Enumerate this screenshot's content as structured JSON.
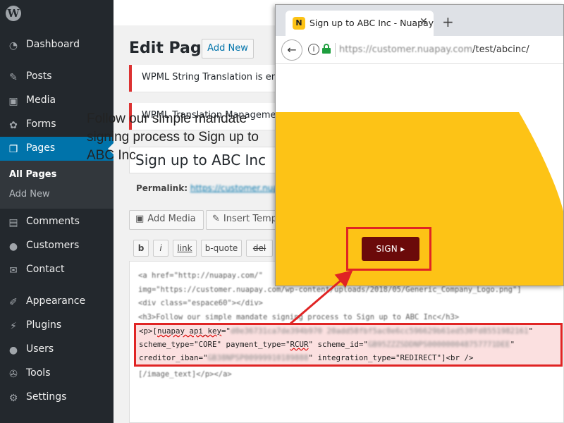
{
  "sidebar": {
    "logo": "W",
    "items": [
      {
        "label": "Dashboard",
        "icon": "dashboard-icon",
        "glyph": "◔"
      },
      {
        "label": "Posts",
        "icon": "pushpin-icon",
        "glyph": "✎"
      },
      {
        "label": "Media",
        "icon": "media-icon",
        "glyph": "▣"
      },
      {
        "label": "Forms",
        "icon": "forms-icon",
        "glyph": "✿"
      },
      {
        "label": "Pages",
        "icon": "pages-icon",
        "glyph": "❐"
      },
      {
        "label": "Comments",
        "icon": "comment-icon",
        "glyph": "▤"
      },
      {
        "label": "Customers",
        "icon": "person-icon",
        "glyph": "●"
      },
      {
        "label": "Contact",
        "icon": "envelope-icon",
        "glyph": "✉"
      },
      {
        "label": "Appearance",
        "icon": "paintbrush-icon",
        "glyph": "✐"
      },
      {
        "label": "Plugins",
        "icon": "plug-icon",
        "glyph": "⚡"
      },
      {
        "label": "Users",
        "icon": "users-icon",
        "glyph": "●"
      },
      {
        "label": "Tools",
        "icon": "wrench-icon",
        "glyph": "✇"
      },
      {
        "label": "Settings",
        "icon": "settings-icon",
        "glyph": "⚙"
      }
    ],
    "submenu": {
      "all_pages": "All Pages",
      "add_new": "Add New"
    }
  },
  "editor": {
    "heading": "Edit Page",
    "add_new": "Add New",
    "notice_1": "WPML String Translation is enabl",
    "notice_2": "WPML Translation Management",
    "title_value": "Sign up to ABC Inc",
    "permalink_label": "Permalink:",
    "permalink_url": "https://customer.nuapay",
    "add_media": "Add Media",
    "insert_template": "Insert Temp",
    "quicktags": [
      "b",
      "i",
      "link",
      "b-quote",
      "del"
    ],
    "code_lines": [
      "<a href=\"http://nuapay.com/\"",
      "img=\"https://customer.nuapay.com/wp-content/uploads/2018/05/Generic_Company_Logo.png\"]",
      "<div class=\"espace60\"></div>",
      "<h3>Follow our simple mandate signing process to Sign up to ABC Inc</h3>",
      "[/image_text]</p></a>"
    ]
  },
  "shortcode": {
    "line1_a": "<p>[",
    "line1_b": "nuapay api_key",
    "line1_c": "=\"",
    "line1_key": "d0e36731ca7de394b970 20add58fbf5ac0e6cc596629b61ed530fd8551982161",
    "line1_d": "\"",
    "line2_a": "scheme_type=\"CORE\" payment_type=\"",
    "line2_b": "RCUR",
    "line2_c": "\" scheme_id=\"",
    "line2_id": "GB95ZZZSDDNPS000000048757771DEE",
    "line2_d": "\"",
    "line3_a": "creditor_iban=\"",
    "line3_iban": "GB38NPSP00999910189888",
    "line3_b": "\" integration_type=\"REDIRECT\"]<br />"
  },
  "browser": {
    "tab_title": "Sign up to ABC Inc - Nuapay",
    "favicon": "N",
    "url_prefix": "https://customer.",
    "url_host": "nuapay.com",
    "url_path": "/test/abcinc/",
    "headline": "Follow our simple mandate signing process to Sign up to ABC Inc",
    "sign_button": "SIGN ▸"
  },
  "colors": {
    "wp_sidebar": "#23282d",
    "wp_accent": "#0073aa",
    "nuapay_yellow": "#fdc316",
    "sign_button": "#6b0a0a",
    "highlight_red": "#e02424"
  }
}
